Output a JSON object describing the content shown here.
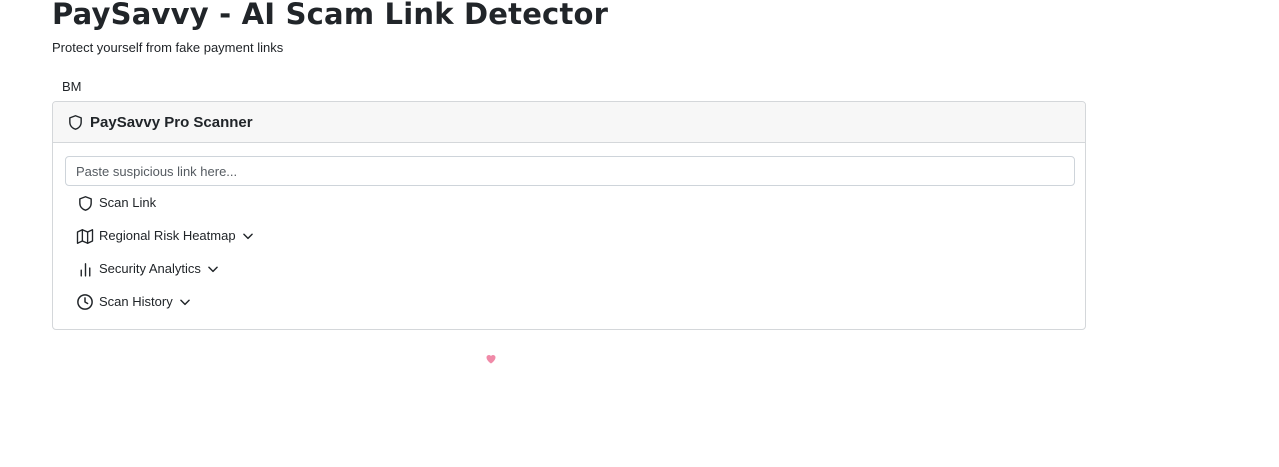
{
  "header": {
    "title": "PaySavvy - AI Scam Link Detector",
    "subtitle": "Protect yourself from fake payment links"
  },
  "user": {
    "initials": "BM"
  },
  "scanner": {
    "title": "PaySavvy Pro Scanner",
    "input": {
      "placeholder": "Paste suspicious link here...",
      "value": ""
    },
    "actions": [
      {
        "label": "Scan Link",
        "icon": "shield-icon",
        "expandable": false
      },
      {
        "label": "Regional Risk Heatmap",
        "icon": "map-icon",
        "expandable": true
      },
      {
        "label": "Security Analytics",
        "icon": "bar-chart-icon",
        "expandable": true
      },
      {
        "label": "Scan History",
        "icon": "clock-icon",
        "expandable": true
      }
    ]
  },
  "decoration": {
    "heart_icon": "heart-icon",
    "heart_color": "#f08aa8"
  }
}
